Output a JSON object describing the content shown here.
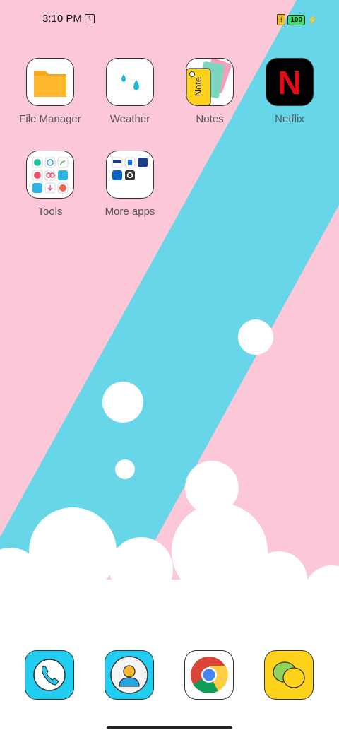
{
  "status_bar": {
    "time": "3:10 PM",
    "calendar_day": "1",
    "battery_level": "100"
  },
  "home_apps": [
    {
      "label": "File Manager",
      "icon": "folder-icon"
    },
    {
      "label": "Weather",
      "icon": "weather-drops-icon"
    },
    {
      "label": "Notes",
      "icon": "notes-icon",
      "icon_text": "Note"
    },
    {
      "label": "Netflix",
      "icon": "netflix-icon",
      "icon_text": "N"
    },
    {
      "label": "Tools",
      "icon": "tools-folder-icon"
    },
    {
      "label": "More apps",
      "icon": "more-apps-folder-icon"
    }
  ],
  "dock": [
    {
      "name": "phone",
      "icon": "phone-icon"
    },
    {
      "name": "contacts",
      "icon": "contacts-icon"
    },
    {
      "name": "chrome",
      "icon": "chrome-icon"
    },
    {
      "name": "messaging",
      "icon": "chat-bubbles-icon"
    }
  ],
  "colors": {
    "wallpaper_pink": "#fcc7d6",
    "wallpaper_stripe": "#66d6e8",
    "folder_orange": "#ffb82e",
    "netflix_red": "#e50914",
    "dock_cyan": "#21cdf0",
    "dock_yellow": "#ffd21c"
  }
}
